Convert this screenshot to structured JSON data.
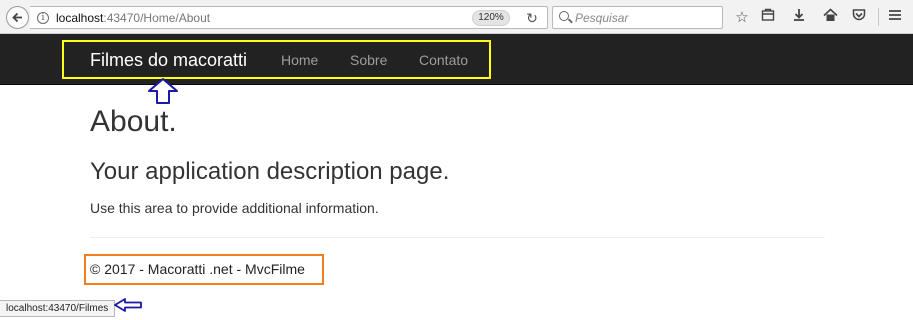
{
  "browser": {
    "url_host": "localhost",
    "url_rest": ":43470/Home/About",
    "zoom": "120%",
    "search_placeholder": "Pesquisar",
    "icons": [
      "back-icon",
      "info-icon",
      "reload-icon",
      "search-icon",
      "star-icon",
      "reading-list-icon",
      "download-icon",
      "home-icon",
      "pocket-icon",
      "menu-icon"
    ]
  },
  "site": {
    "brand": "Filmes do macoratti",
    "nav": [
      "Home",
      "Sobre",
      "Contato"
    ],
    "nav_highlight_color": "#ffff1a",
    "footer_highlight_color": "#f07f1e",
    "arrow_color": "#1a1aa6"
  },
  "main": {
    "title": "About.",
    "subtitle": "Your application description page.",
    "body": "Use this area to provide additional information."
  },
  "footer": {
    "text": "© 2017 - Macoratti .net - MvcFilme"
  },
  "status_bar": {
    "link": "localhost:43470/Filmes"
  }
}
